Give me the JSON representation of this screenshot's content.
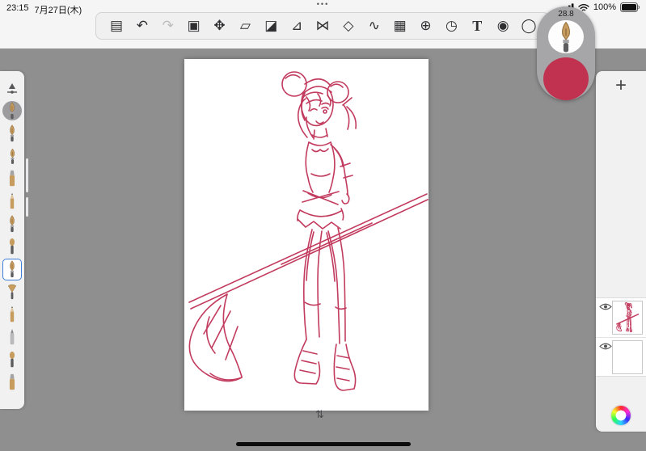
{
  "status_bar": {
    "time": "23:15",
    "date": "7月27日(木)",
    "center_dots": "•••",
    "battery_percent": "100%"
  },
  "toolbar": {
    "tools": [
      {
        "name": "tool-settings",
        "glyph": "▤"
      },
      {
        "name": "undo",
        "glyph": "↶"
      },
      {
        "name": "redo",
        "glyph": "↷"
      },
      {
        "name": "marquee-select",
        "glyph": "▣"
      },
      {
        "name": "move",
        "glyph": "✥"
      },
      {
        "name": "transform",
        "glyph": "▱"
      },
      {
        "name": "eraser",
        "glyph": "◪"
      },
      {
        "name": "ruler",
        "glyph": "⊿"
      },
      {
        "name": "symmetry",
        "glyph": "⋈"
      },
      {
        "name": "shape",
        "glyph": "◇"
      },
      {
        "name": "curve",
        "glyph": "∿"
      },
      {
        "name": "image",
        "glyph": "▦"
      },
      {
        "name": "perspective",
        "glyph": "⊕"
      },
      {
        "name": "material",
        "glyph": "◷"
      },
      {
        "name": "text",
        "glyph": "T"
      },
      {
        "name": "camera",
        "glyph": "◉"
      },
      {
        "name": "lasso",
        "glyph": "◯"
      }
    ]
  },
  "brush_panel": {
    "brush_size": "28.8",
    "current_color": "#c13150"
  },
  "left_toolbar": {
    "brushes": [
      {
        "name": "brush-size-slider"
      },
      {
        "name": "active-pen"
      },
      {
        "name": "pen"
      },
      {
        "name": "mapping-pen"
      },
      {
        "name": "marker"
      },
      {
        "name": "pencil"
      },
      {
        "name": "ink-pen"
      },
      {
        "name": "script-pen"
      },
      {
        "name": "selected-pen"
      },
      {
        "name": "fan-brush"
      },
      {
        "name": "soft-pencil"
      },
      {
        "name": "airbrush"
      },
      {
        "name": "round-brush"
      },
      {
        "name": "flat-marker"
      }
    ]
  },
  "right_sidebar": {
    "add_layer_label": "+",
    "layers": [
      {
        "name": "sketch-layer",
        "visible": true,
        "selected": true,
        "has_artwork": true
      },
      {
        "name": "empty-layer",
        "visible": true,
        "selected": false,
        "has_artwork": false
      }
    ]
  },
  "canvas": {
    "artwork_description": "rough crimson sketch of a girl with double hair buns, winking, one arm raised, short skirt and lace-up boots, holding a large scythe whose pole crosses the canvas diagonally",
    "ink_color": "#c23b5e"
  },
  "view_controls": {
    "rotate_glyph": "⇅"
  }
}
